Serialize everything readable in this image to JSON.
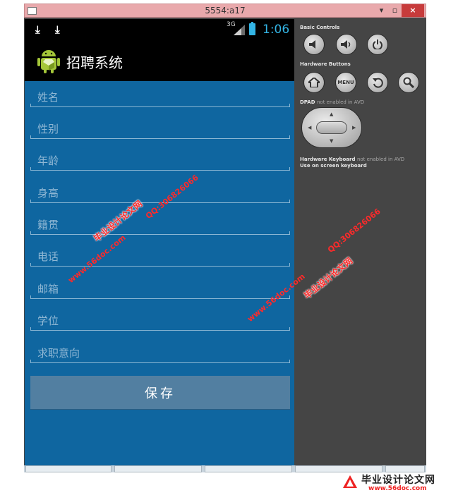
{
  "window": {
    "title": "5554:a17",
    "minimize": "▾",
    "restore": "▫",
    "close": "×"
  },
  "status_bar": {
    "network": "3G",
    "time": "1:06"
  },
  "app": {
    "title": "招聘系统"
  },
  "form": {
    "fields": [
      {
        "placeholder": "姓名",
        "value": ""
      },
      {
        "placeholder": "性别",
        "value": ""
      },
      {
        "placeholder": "年龄",
        "value": ""
      },
      {
        "placeholder": "身高",
        "value": ""
      },
      {
        "placeholder": "籍贯",
        "value": ""
      },
      {
        "placeholder": "电话",
        "value": ""
      },
      {
        "placeholder": "邮箱",
        "value": ""
      },
      {
        "placeholder": "学位",
        "value": ""
      },
      {
        "placeholder": "求职意向",
        "value": ""
      }
    ],
    "save_label": "保存"
  },
  "controls": {
    "basic_title": "Basic Controls",
    "hardware_title": "Hardware Buttons",
    "menu_label": "MENU",
    "dpad_title": "DPAD",
    "dpad_note": "not enabled in AVD",
    "keyboard_title": "Hardware Keyboard",
    "keyboard_note": "not enabled in AVD",
    "keyboard_hint": "Use on screen keyboard"
  },
  "watermarks": {
    "site": "www.56doc.com",
    "brand": "毕业设计论文网",
    "qq": "QQ:306826066"
  },
  "footer": {
    "brand": "毕业设计论文网",
    "url": "www.56doc.com"
  },
  "colors": {
    "screen_bg": "#0f66a0",
    "save_button": "#527fa1",
    "accent": "#33b5e5",
    "watermark": "#ff2a2a"
  },
  "icons": [
    "download-icon",
    "signal-icon",
    "battery-icon",
    "android-logo-icon",
    "volume-down-icon",
    "volume-up-icon",
    "power-icon",
    "home-icon",
    "back-icon",
    "search-icon",
    "dpad-icon"
  ]
}
